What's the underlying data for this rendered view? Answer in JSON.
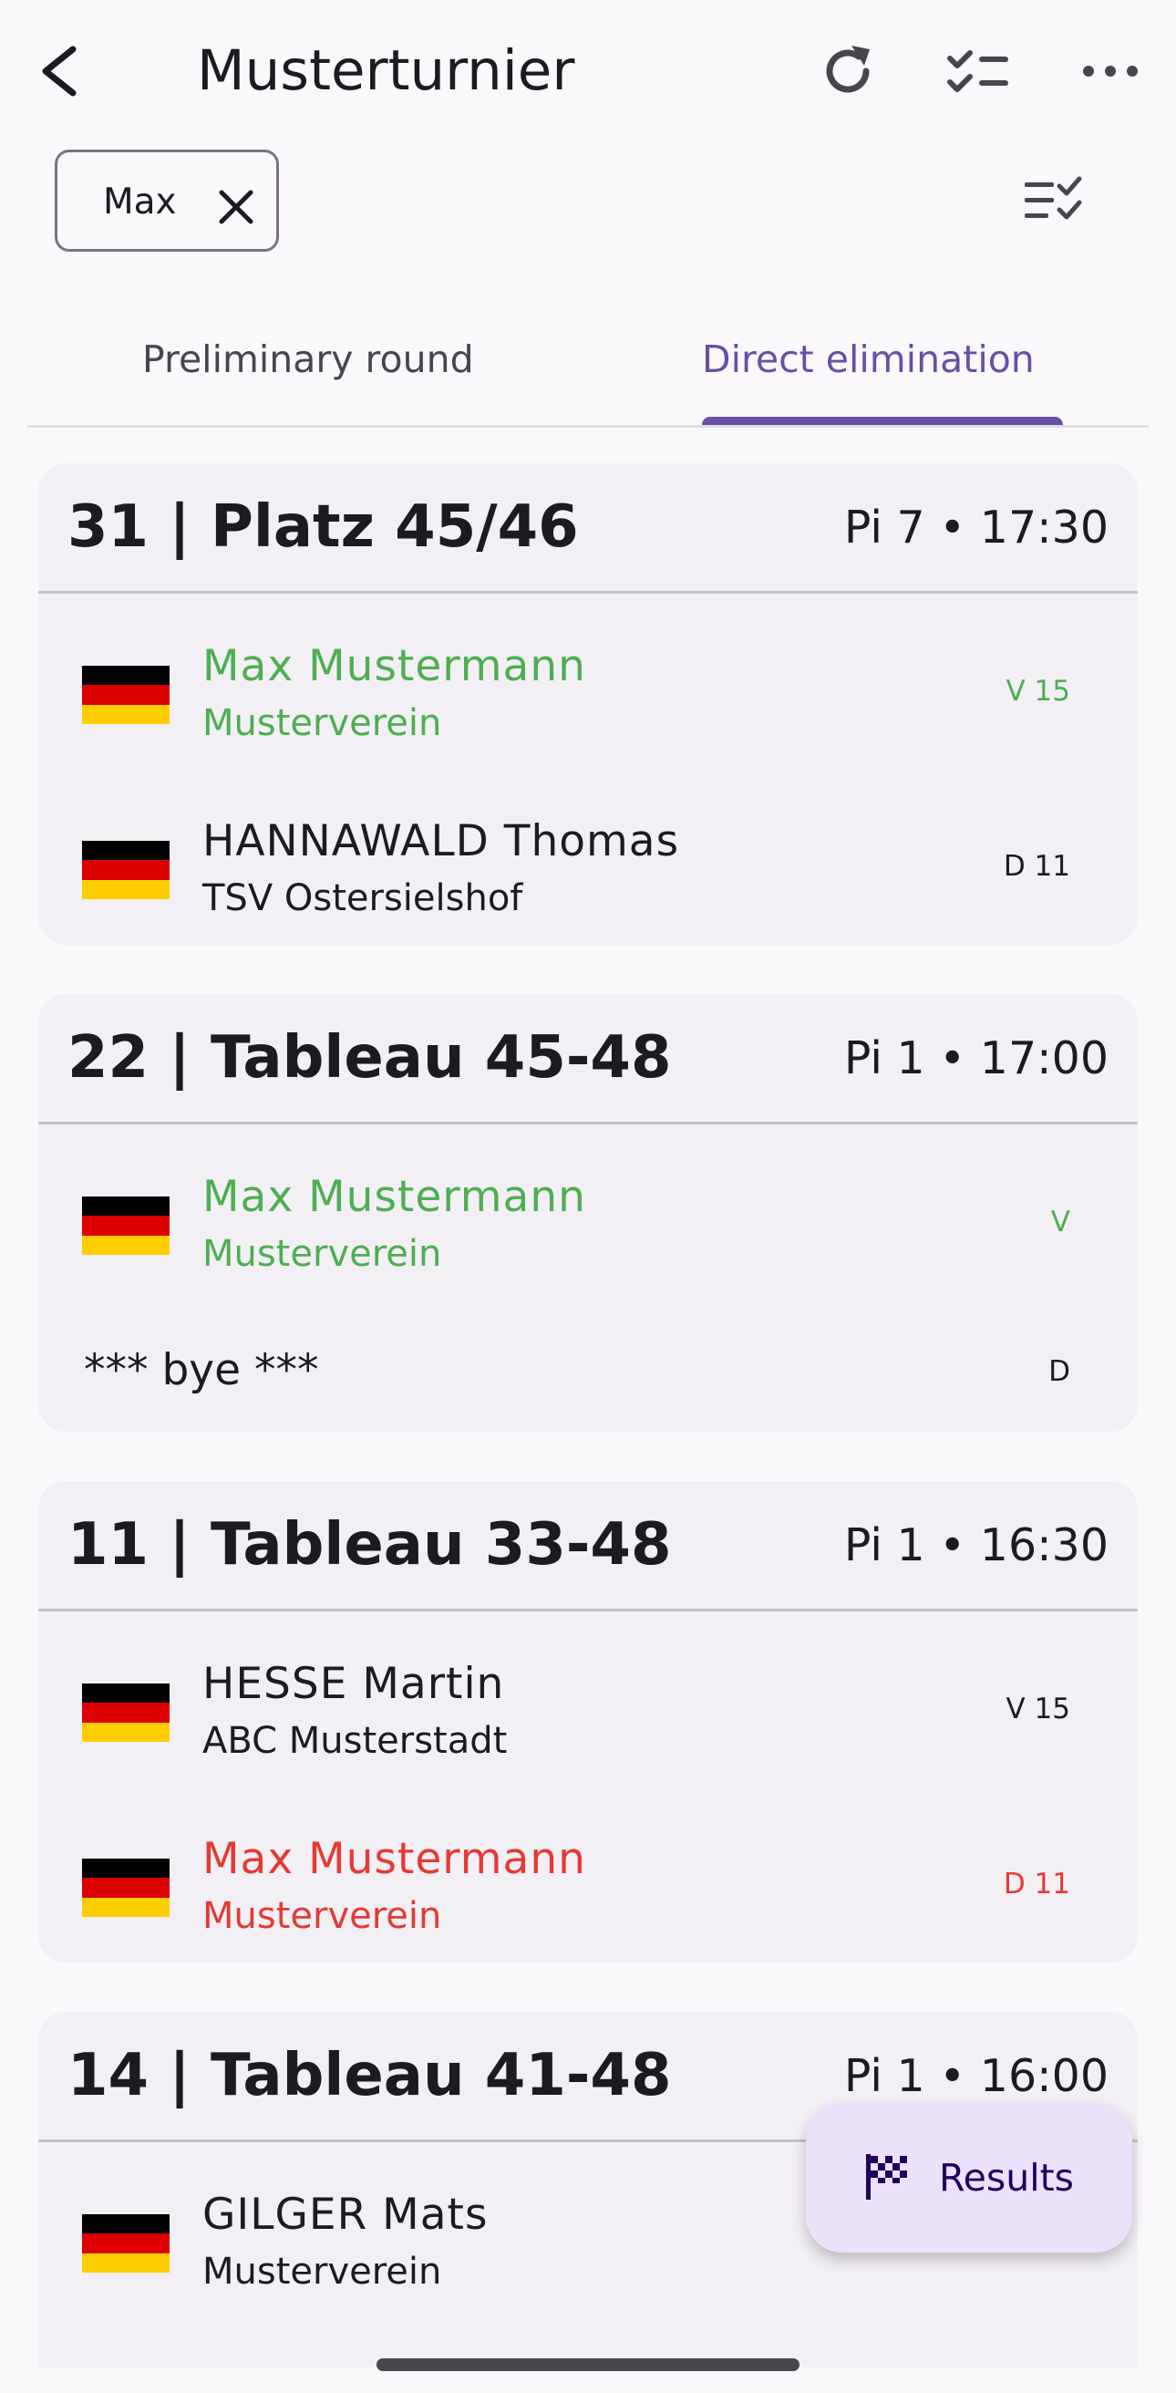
{
  "appbar": {
    "title": "Musterturnier"
  },
  "filter": {
    "chip_label": "Max"
  },
  "tabs": [
    {
      "label": "Preliminary round",
      "selected": false
    },
    {
      "label": "Direct elimination",
      "selected": true
    }
  ],
  "colors": {
    "accent": "#6750a4",
    "win": "#4caf50",
    "loss": "#e53935",
    "fab_bg": "#ebe1fb"
  },
  "matches": [
    {
      "title": "31 | Platz 45/46",
      "meta": "Pi 7 • 17:30",
      "fencers": [
        {
          "flag": "de-flag-icon",
          "name": "Max Mustermann",
          "club": "Musterverein",
          "score": "V 15",
          "status": "win"
        },
        {
          "flag": "de-flag-icon",
          "name": "HANNAWALD Thomas",
          "club": "TSV Ostersielshof",
          "score": "D 11",
          "status": "neutral"
        }
      ]
    },
    {
      "title": "22 | Tableau 45-48",
      "meta": "Pi 1 • 17:00",
      "fencers": [
        {
          "flag": "de-flag-icon",
          "name": "Max Mustermann",
          "club": "Musterverein",
          "score": "V",
          "status": "win"
        },
        {
          "name": "*** bye ***",
          "score": "D",
          "status": "neutral"
        }
      ]
    },
    {
      "title": "11 | Tableau 33-48",
      "meta": "Pi 1 • 16:30",
      "fencers": [
        {
          "flag": "de-flag-icon",
          "name": "HESSE Martin",
          "club": "ABC Musterstadt",
          "score": "V 15",
          "status": "neutral"
        },
        {
          "flag": "de-flag-icon",
          "name": "Max Mustermann",
          "club": "Musterverein",
          "score": "D 11",
          "status": "loss"
        }
      ]
    },
    {
      "title": "14 | Tableau 41-48",
      "meta": "Pi 1 • 16:00",
      "fencers": [
        {
          "flag": "de-flag-icon",
          "name": "GILGER Mats",
          "club": "Musterverein",
          "score": "",
          "status": "neutral"
        }
      ]
    }
  ],
  "fab": {
    "label": "Results",
    "icon": "checkered-flag-icon"
  }
}
